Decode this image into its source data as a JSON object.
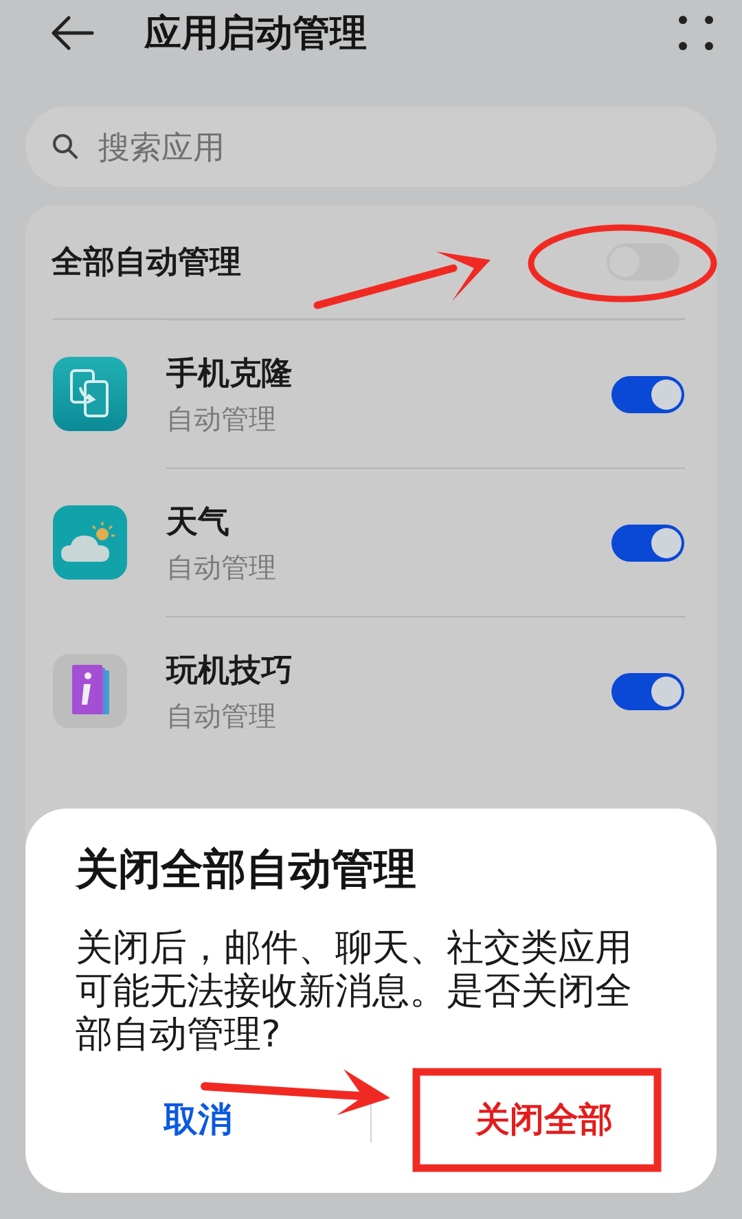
{
  "header": {
    "title": "应用启动管理"
  },
  "search": {
    "placeholder": "搜索应用"
  },
  "master": {
    "label": "全部自动管理",
    "on": false
  },
  "apps": [
    {
      "name": "手机克隆",
      "subtitle": "自动管理",
      "on": true
    },
    {
      "name": "天气",
      "subtitle": "自动管理",
      "on": true
    },
    {
      "name": "玩机技巧",
      "subtitle": "自动管理",
      "on": true
    }
  ],
  "dialog": {
    "title": "关闭全部自动管理",
    "message": "关闭后，邮件、聊天、社交类应用可能无法接收新消息。是否关闭全部自动管理?",
    "buttons": [
      {
        "label": "取消",
        "kind": "cancel"
      },
      {
        "label": "关闭全部",
        "kind": "confirm"
      }
    ]
  }
}
